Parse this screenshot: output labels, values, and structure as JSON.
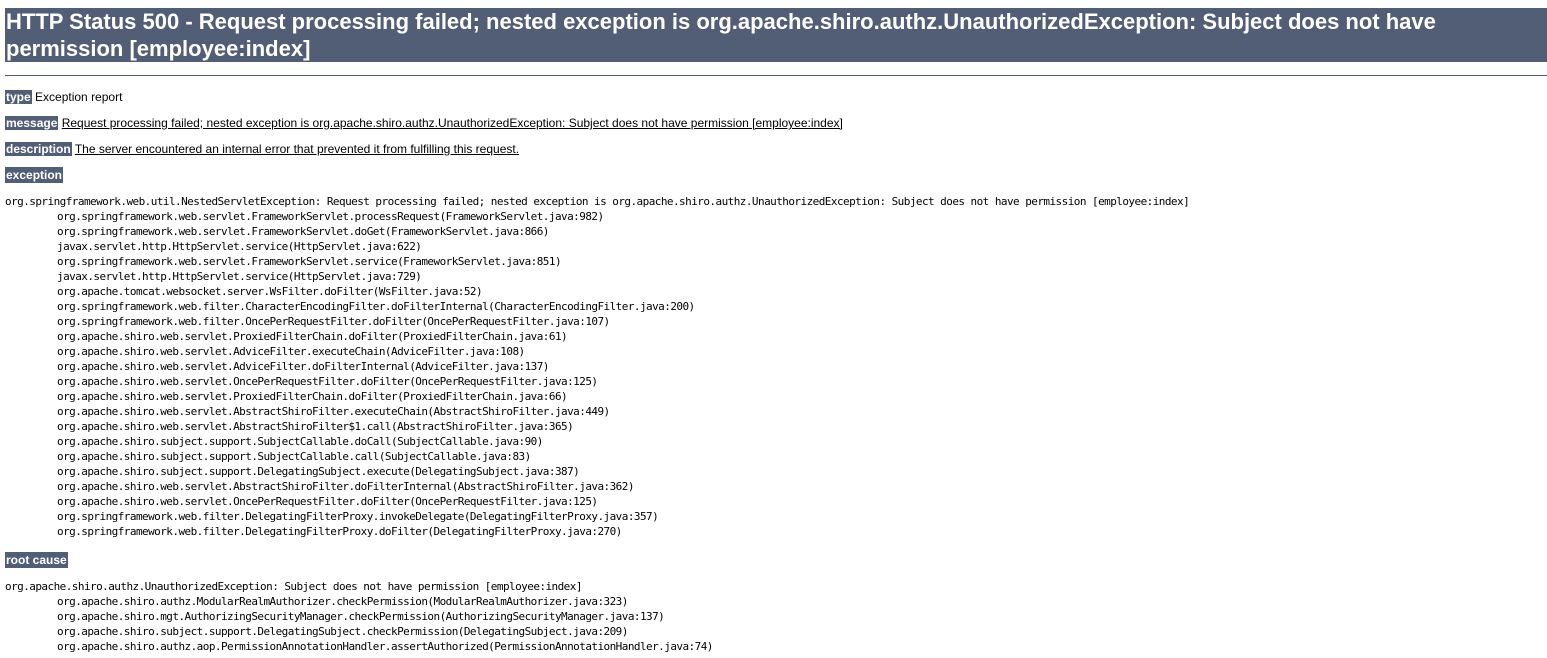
{
  "title": "HTTP Status 500 - Request processing failed; nested exception is org.apache.shiro.authz.UnauthorizedException: Subject does not have permission [employee:index]",
  "type": {
    "label": "type",
    "value": "Exception report"
  },
  "message": {
    "label": "message",
    "value": "Request processing failed; nested exception is org.apache.shiro.authz.UnauthorizedException: Subject does not have permission [employee:index]"
  },
  "description": {
    "label": "description",
    "value": "The server encountered an internal error that prevented it from fulfilling this request."
  },
  "exception": {
    "label": "exception",
    "head": "org.springframework.web.util.NestedServletException: Request processing failed; nested exception is org.apache.shiro.authz.UnauthorizedException: Subject does not have permission [employee:index]",
    "frames": [
      "org.springframework.web.servlet.FrameworkServlet.processRequest(FrameworkServlet.java:982)",
      "org.springframework.web.servlet.FrameworkServlet.doGet(FrameworkServlet.java:866)",
      "javax.servlet.http.HttpServlet.service(HttpServlet.java:622)",
      "org.springframework.web.servlet.FrameworkServlet.service(FrameworkServlet.java:851)",
      "javax.servlet.http.HttpServlet.service(HttpServlet.java:729)",
      "org.apache.tomcat.websocket.server.WsFilter.doFilter(WsFilter.java:52)",
      "org.springframework.web.filter.CharacterEncodingFilter.doFilterInternal(CharacterEncodingFilter.java:200)",
      "org.springframework.web.filter.OncePerRequestFilter.doFilter(OncePerRequestFilter.java:107)",
      "org.apache.shiro.web.servlet.ProxiedFilterChain.doFilter(ProxiedFilterChain.java:61)",
      "org.apache.shiro.web.servlet.AdviceFilter.executeChain(AdviceFilter.java:108)",
      "org.apache.shiro.web.servlet.AdviceFilter.doFilterInternal(AdviceFilter.java:137)",
      "org.apache.shiro.web.servlet.OncePerRequestFilter.doFilter(OncePerRequestFilter.java:125)",
      "org.apache.shiro.web.servlet.ProxiedFilterChain.doFilter(ProxiedFilterChain.java:66)",
      "org.apache.shiro.web.servlet.AbstractShiroFilter.executeChain(AbstractShiroFilter.java:449)",
      "org.apache.shiro.web.servlet.AbstractShiroFilter$1.call(AbstractShiroFilter.java:365)",
      "org.apache.shiro.subject.support.SubjectCallable.doCall(SubjectCallable.java:90)",
      "org.apache.shiro.subject.support.SubjectCallable.call(SubjectCallable.java:83)",
      "org.apache.shiro.subject.support.DelegatingSubject.execute(DelegatingSubject.java:387)",
      "org.apache.shiro.web.servlet.AbstractShiroFilter.doFilterInternal(AbstractShiroFilter.java:362)",
      "org.apache.shiro.web.servlet.OncePerRequestFilter.doFilter(OncePerRequestFilter.java:125)",
      "org.springframework.web.filter.DelegatingFilterProxy.invokeDelegate(DelegatingFilterProxy.java:357)",
      "org.springframework.web.filter.DelegatingFilterProxy.doFilter(DelegatingFilterProxy.java:270)"
    ]
  },
  "root_cause": {
    "label": "root cause",
    "head": "org.apache.shiro.authz.UnauthorizedException: Subject does not have permission [employee:index]",
    "frames": [
      "org.apache.shiro.authz.ModularRealmAuthorizer.checkPermission(ModularRealmAuthorizer.java:323)",
      "org.apache.shiro.mgt.AuthorizingSecurityManager.checkPermission(AuthorizingSecurityManager.java:137)",
      "org.apache.shiro.subject.support.DelegatingSubject.checkPermission(DelegatingSubject.java:209)",
      "org.apache.shiro.authz.aop.PermissionAnnotationHandler.assertAuthorized(PermissionAnnotationHandler.java:74)"
    ]
  }
}
